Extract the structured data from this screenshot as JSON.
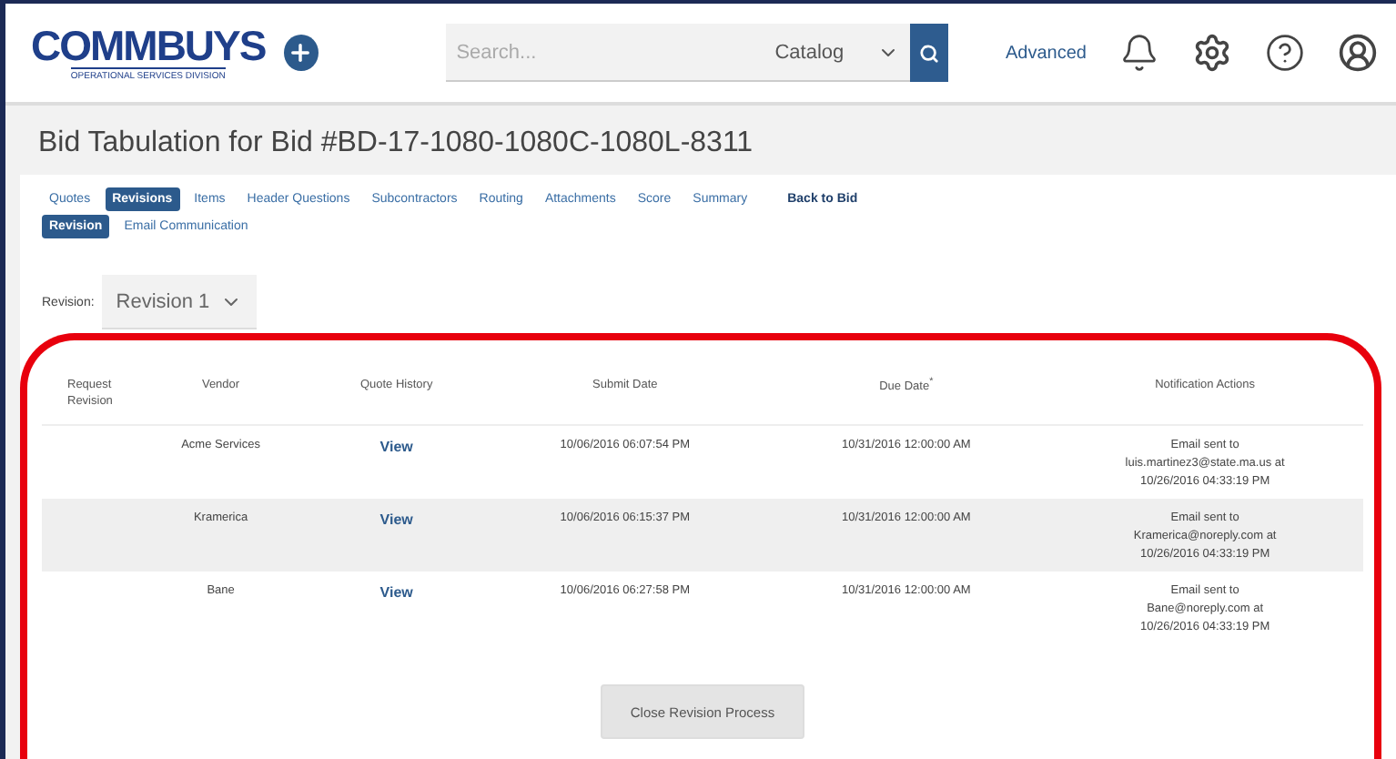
{
  "header": {
    "logo": {
      "title": "COMMBUYS",
      "subtitle": "OPERATIONAL SERVICES DIVISION"
    },
    "search": {
      "placeholder": "Search...",
      "scope": "Catalog"
    },
    "advanced_link": "Advanced"
  },
  "page_title": "Bid Tabulation for Bid #BD-17-1080-1080C-1080L-8311",
  "tabs": [
    {
      "label": "Quotes",
      "selected": false
    },
    {
      "label": "Revisions",
      "selected": true
    },
    {
      "label": "Items",
      "selected": false
    },
    {
      "label": "Header Questions",
      "selected": false
    },
    {
      "label": "Subcontractors",
      "selected": false
    },
    {
      "label": "Routing",
      "selected": false
    },
    {
      "label": "Attachments",
      "selected": false
    },
    {
      "label": "Score",
      "selected": false
    },
    {
      "label": "Summary",
      "selected": false
    }
  ],
  "back_link": "Back to Bid",
  "subtabs": [
    {
      "label": "Revision",
      "selected": true
    },
    {
      "label": "Email Communication",
      "selected": false
    }
  ],
  "revision": {
    "label": "Revision:",
    "value": "Revision 1"
  },
  "table": {
    "columns": [
      "Request\nRevision",
      "Vendor",
      "Quote History",
      "Submit Date",
      "Due Date$^{*}$",
      "Notification Actions"
    ],
    "rows": [
      {
        "vendor": "Acme Services",
        "quote_history": "View",
        "submit_date": "10/06/2016 06:07:54 PM",
        "due_date": "10/31/2016 12:00:00 AM",
        "notification": "Email sent to\nluis.martinez3@state.ma.us at\n10/26/2016 04:33:19 PM"
      },
      {
        "vendor": "Kramerica",
        "quote_history": "View",
        "submit_date": "10/06/2016 06:15:37 PM",
        "due_date": "10/31/2016 12:00:00 AM",
        "notification": "Email sent to\nKramerica@noreply.com at\n10/26/2016 04:33:19 PM"
      },
      {
        "vendor": "Bane",
        "quote_history": "View",
        "submit_date": "10/06/2016 06:27:58 PM",
        "due_date": "10/31/2016 12:00:00 AM",
        "notification": "Email sent to\nBane@noreply.com at\n10/26/2016 04:33:19 PM"
      }
    ]
  },
  "close_button": "Close Revision Process"
}
